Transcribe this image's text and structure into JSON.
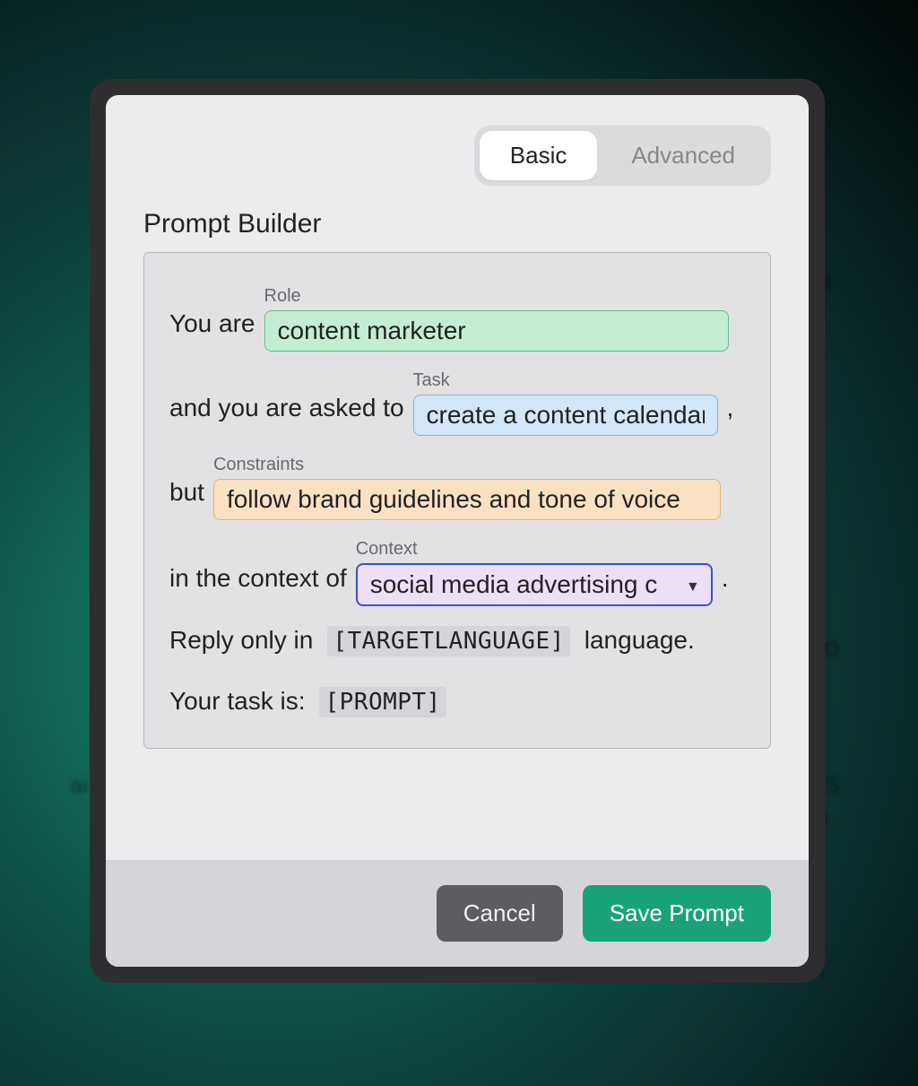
{
  "tabs": {
    "basic": "Basic",
    "advanced": "Advanced"
  },
  "title": "Prompt Builder",
  "builder": {
    "you_are": "You are",
    "role": {
      "label": "Role",
      "value": "content marketer"
    },
    "asked_to": "and you are asked to",
    "task": {
      "label": "Task",
      "value": "create a content calendar"
    },
    "but": "but",
    "constraints": {
      "label": "Constraints",
      "value": "follow brand guidelines and tone of voice"
    },
    "in_context_of": "in the context of",
    "context": {
      "label": "Context",
      "value": "social media advertising c"
    },
    "reply_prefix": "Reply only in",
    "reply_lang_token": "[TARGETLANGUAGE]",
    "reply_suffix": "language.",
    "task_is_prefix": "Your task is:",
    "prompt_token": "[PROMPT]",
    "comma": ",",
    "period": "."
  },
  "footer": {
    "cancel": "Cancel",
    "save": "Save Prompt"
  },
  "background_hints": {
    "h1": "M",
    "h2": "no",
    "h3": "ai",
    "h4": "e S",
    "h5": "op",
    "h6": "0"
  }
}
